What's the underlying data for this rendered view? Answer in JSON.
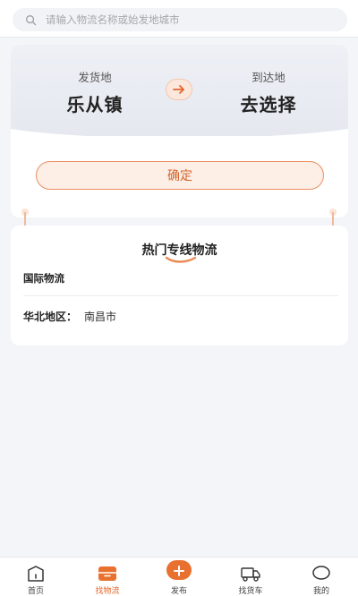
{
  "search": {
    "placeholder": "请输入物流名称或始发地城市"
  },
  "route": {
    "from_label": "发货地",
    "from_city": "乐从镇",
    "to_label": "到达地",
    "to_city": "去选择",
    "confirm_label": "确定"
  },
  "hot_lines": {
    "title": "热门专线物流",
    "section_label": "国际物流",
    "region_label": "华北地区：",
    "region_city": "南昌市"
  },
  "tabbar": {
    "items": [
      {
        "label": "首页",
        "icon": "home-icon",
        "active": false
      },
      {
        "label": "找物流",
        "icon": "logistics-icon",
        "active": true
      },
      {
        "label": "发布",
        "icon": "plus-icon",
        "active": false
      },
      {
        "label": "找货车",
        "icon": "truck-icon",
        "active": false
      },
      {
        "label": "我的",
        "icon": "user-icon",
        "active": false
      }
    ]
  },
  "colors": {
    "accent": "#e2672c",
    "background": "#f4f5f8"
  }
}
